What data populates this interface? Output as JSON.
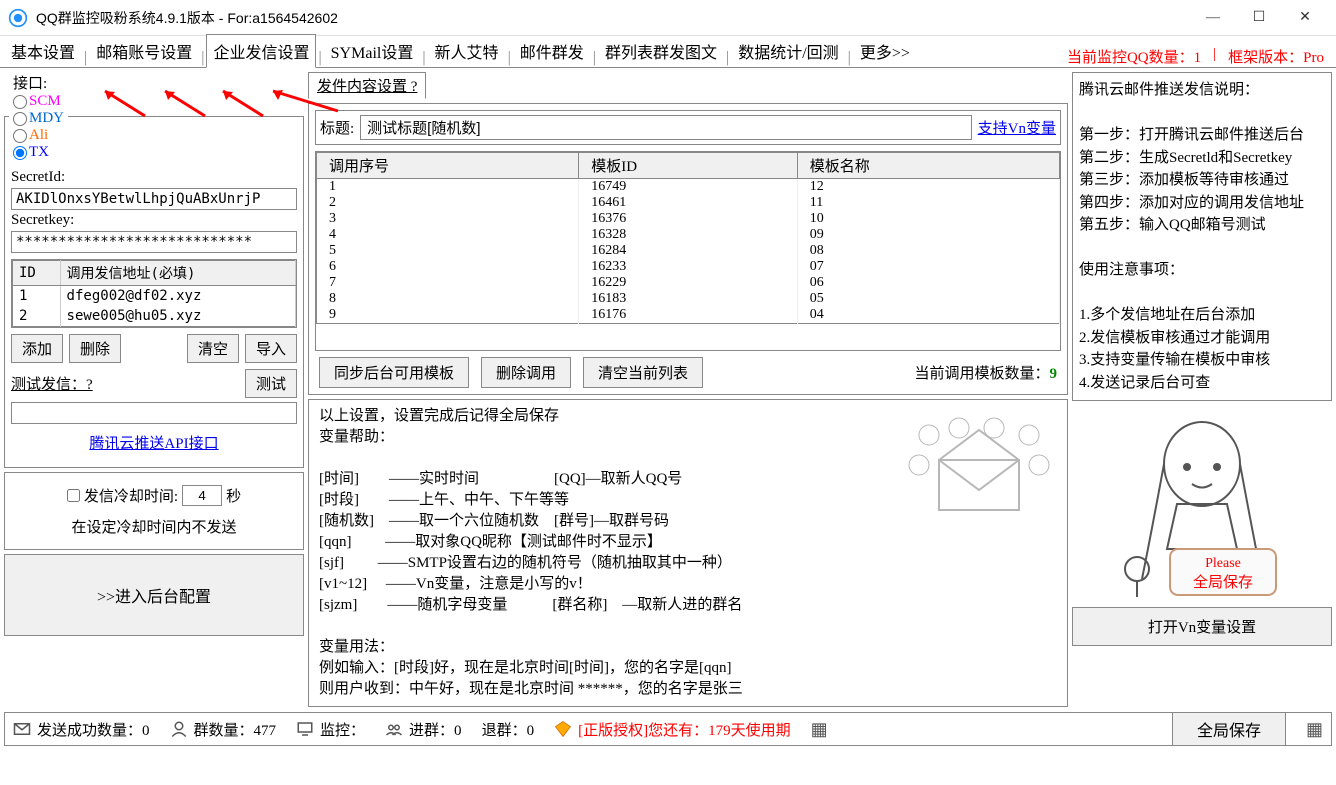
{
  "window": {
    "title": "QQ群监控吸粉系统4.9.1版本 - For:a1564542602"
  },
  "tabs": {
    "items": [
      "基本设置",
      "邮箱账号设置",
      "企业发信设置",
      "SYMail设置",
      "新人艾特",
      "邮件群发",
      "群列表群发图文",
      "数据统计/回测",
      "更多>>"
    ],
    "active": 2
  },
  "status_top": {
    "monitor": "当前监控QQ数量：1",
    "version": "框架版本：Pro"
  },
  "interface": {
    "legend": "接口:",
    "options": [
      {
        "label": "SCM",
        "cls": "scm"
      },
      {
        "label": "MDY",
        "cls": "mdy"
      },
      {
        "label": "Ali",
        "cls": "ali"
      },
      {
        "label": "TX",
        "cls": "tx"
      }
    ],
    "selected": 3
  },
  "secret": {
    "id_label": "SecretId:",
    "id_value": "AKIDlOnxsYBetwlLhpjQuABxUnrjP",
    "key_label": "Secretkey:",
    "key_value": "****************************"
  },
  "addr_table": {
    "headers": [
      "ID",
      "调用发信地址(必填)"
    ],
    "rows": [
      {
        "id": "1",
        "addr": "dfeg002@df02.xyz"
      },
      {
        "id": "2",
        "addr": "sewe005@hu05.xyz"
      }
    ]
  },
  "left_btns": {
    "add": "添加",
    "del": "删除",
    "clear": "清空",
    "import": "导入",
    "test_lbl": "测试发信：?",
    "test": "测试"
  },
  "api_link": "腾讯云推送API接口",
  "cooldown": {
    "chk": "发信冷却时间:",
    "val": "4",
    "unit": "秒",
    "note": "在设定冷却时间内不发送"
  },
  "enter_btn": ">>进入后台配置",
  "content_tab": "发件内容设置 ?",
  "title_row": {
    "lbl": "标题:",
    "val": "测试标题[随机数]",
    "vn": "支持Vn变量"
  },
  "tpl_headers": [
    "调用序号",
    "模板ID",
    "模板名称"
  ],
  "tpl_rows": [
    {
      "seq": "1",
      "id": "16749",
      "name": "12"
    },
    {
      "seq": "2",
      "id": "16461",
      "name": "11"
    },
    {
      "seq": "3",
      "id": "16376",
      "name": "10"
    },
    {
      "seq": "4",
      "id": "16328",
      "name": "09"
    },
    {
      "seq": "5",
      "id": "16284",
      "name": "08"
    },
    {
      "seq": "6",
      "id": "16233",
      "name": "07"
    },
    {
      "seq": "7",
      "id": "16229",
      "name": "06"
    },
    {
      "seq": "8",
      "id": "16183",
      "name": "05"
    },
    {
      "seq": "9",
      "id": "16176",
      "name": "04"
    }
  ],
  "tpl_btns": {
    "sync": "同步后台可用模板",
    "del": "删除调用",
    "clear": "清空当前列表",
    "count_lbl": "当前调用模板数量：",
    "count": "9"
  },
  "help": {
    "line1": "以上设置，设置完成后记得全局保存",
    "line2": "变量帮助：",
    "v_time": "[时间]　　——实时时间　　　　　[QQ]—取新人QQ号",
    "v_period": "[时段]　　——上午、中午、下午等等",
    "v_rand": "[随机数]　——取一个六位随机数　[群号]—取群号码",
    "v_qqn": "[qqn]　　 ——取对象QQ昵称【测试邮件时不显示】",
    "v_sjf": "[sjf]　　 ——SMTP设置右边的随机符号（随机抽取其中一种）",
    "v_vn": "[v1~12]　 ——Vn变量，注意是小写的v！",
    "v_sjzm": "[sjzm]　　——随机字母变量　　　[群名称]　—取新人进的群名",
    "usage_lbl": "变量用法：",
    "usage1": "例如输入：[时段]好，现在是北京时间[时间]，您的名字是[qqn]",
    "usage2": "则用户收到：中午好，现在是北京时间 ******，您的名字是张三"
  },
  "right_panel": {
    "title": "腾讯云邮件推送发信说明：",
    "s1": "第一步：打开腾讯云邮件推送后台",
    "s2": "第二步：生成Secretld和Secretkey",
    "s3": "第三步：添加模板等待审核通过",
    "s4": "第四步：添加对应的调用发信地址",
    "s5": "第五步：输入QQ邮箱号测试",
    "note_title": "使用注意事项：",
    "n1": "1.多个发信地址在后台添加",
    "n2": "2.发信模板审核通过才能调用",
    "n3": "3.支持变量传输在模板中审核",
    "n4": "4.发送记录后台可查"
  },
  "char_sign": {
    "l1": "Please",
    "l2": "全局保存"
  },
  "vn_btn": "打开Vn变量设置",
  "statusbar": {
    "sent": "发送成功数量：0",
    "groups": "群数量：477",
    "monitor": "监控：",
    "join": "进群：0",
    "leave": "退群：0",
    "auth": "[正版授权]您还有：179天使用期",
    "save": "全局保存"
  }
}
